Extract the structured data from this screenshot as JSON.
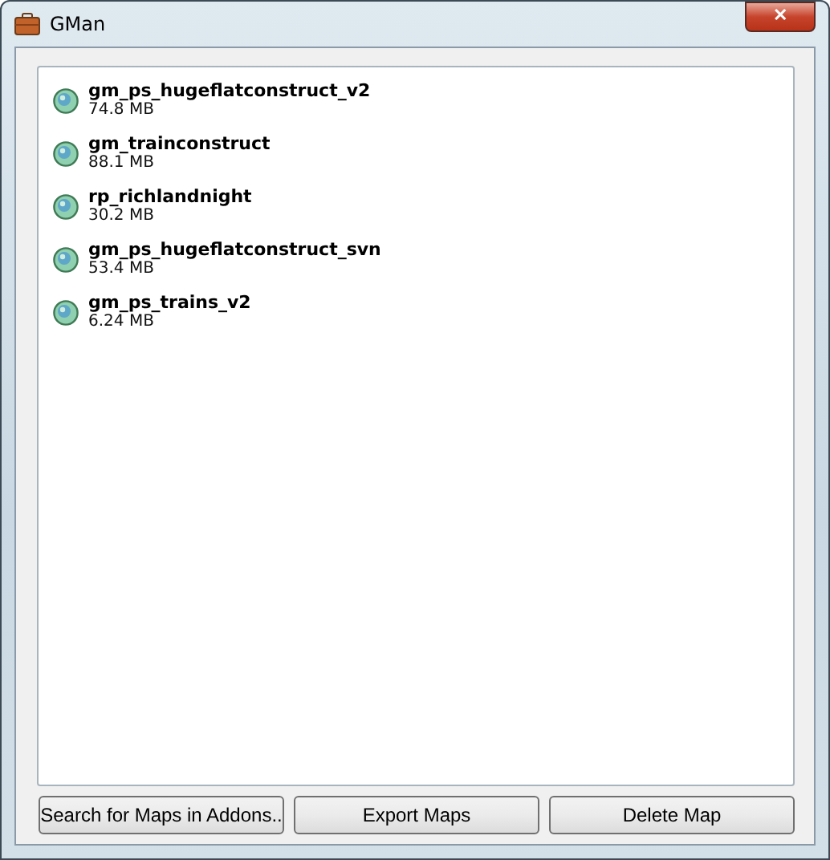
{
  "window": {
    "title": "GMan",
    "close": "✕"
  },
  "maps": [
    {
      "name": "gm_ps_hugeflatconstruct_v2",
      "size": "74.8 MB"
    },
    {
      "name": "gm_trainconstruct",
      "size": "88.1 MB"
    },
    {
      "name": "rp_richlandnight",
      "size": "30.2 MB"
    },
    {
      "name": "gm_ps_hugeflatconstruct_svn",
      "size": "53.4 MB"
    },
    {
      "name": "gm_ps_trains_v2",
      "size": "6.24 MB"
    }
  ],
  "buttons": [
    "Search for Maps in Addons..",
    "Export Maps",
    "Delete Map"
  ]
}
